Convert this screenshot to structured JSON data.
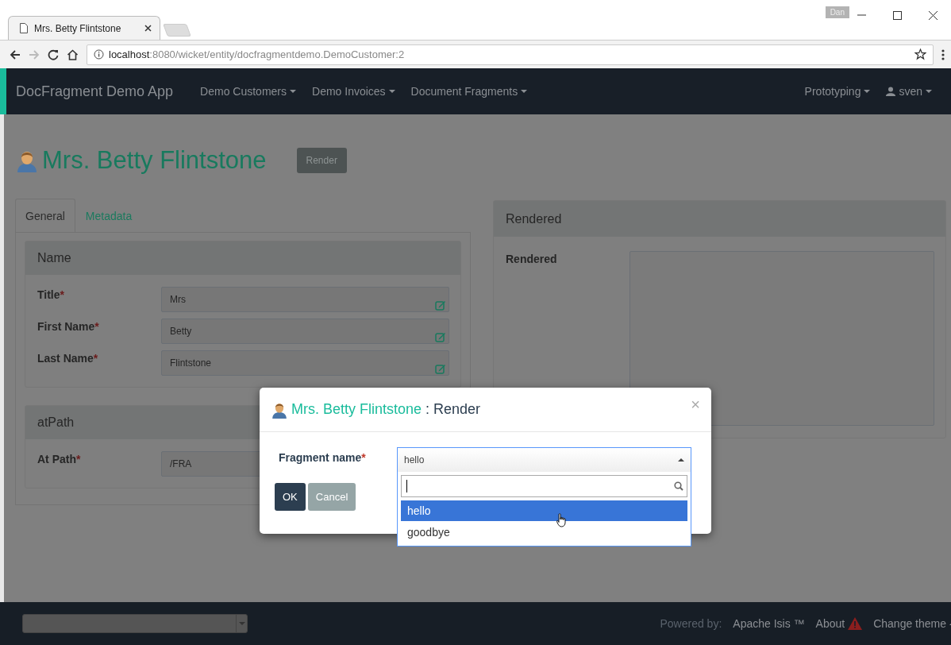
{
  "browser": {
    "tabs": [
      {
        "title": "Mrs. Betty Flintstone",
        "selected": true
      }
    ],
    "profile": "Dan",
    "url": {
      "host": "localhost",
      "path": ":8080/wicket/entity/docfragmentdemo.DemoCustomer:2"
    }
  },
  "navbar": {
    "brand": "DocFragment Demo App",
    "menus": [
      "Demo Customers",
      "Demo Invoices",
      "Document Fragments"
    ],
    "right_menus": [
      {
        "label": "Prototyping",
        "kind": "plain"
      },
      {
        "label": "sven",
        "kind": "user"
      }
    ]
  },
  "page": {
    "title": "Mrs. Betty Flintstone",
    "render_button": "Render",
    "tabs": [
      {
        "label": "General",
        "selected": true
      },
      {
        "label": "Metadata",
        "selected": false
      }
    ],
    "sections": [
      {
        "heading": "Name",
        "fields": [
          {
            "label": "Title",
            "required_mark": "*",
            "value": "Mrs"
          },
          {
            "label": "First Name",
            "required_mark": "*",
            "value": "Betty"
          },
          {
            "label": "Last Name",
            "required_mark": "*",
            "value": "Flintstone"
          }
        ]
      },
      {
        "heading": "atPath",
        "fields": [
          {
            "label": "At Path",
            "required_mark": "*",
            "value": "/FRA"
          }
        ]
      }
    ],
    "rendered": {
      "heading": "Rendered",
      "label": "Rendered"
    }
  },
  "modal": {
    "title_object": "Mrs. Betty Flintstone",
    "title_action": ": Render",
    "close": "×",
    "field_label": "Fragment name",
    "required_mark": "*",
    "value": "hello",
    "options": [
      {
        "label": "hello",
        "selected": true
      },
      {
        "label": "goodbye",
        "selected": false
      }
    ],
    "buttons": [
      {
        "label": "OK",
        "kind": "primary"
      },
      {
        "label": "Cancel",
        "kind": "secondary"
      }
    ]
  },
  "footer": {
    "powered_by": "Powered by:",
    "links": [
      "Apache Isis ™",
      "About",
      "Change theme"
    ]
  }
}
